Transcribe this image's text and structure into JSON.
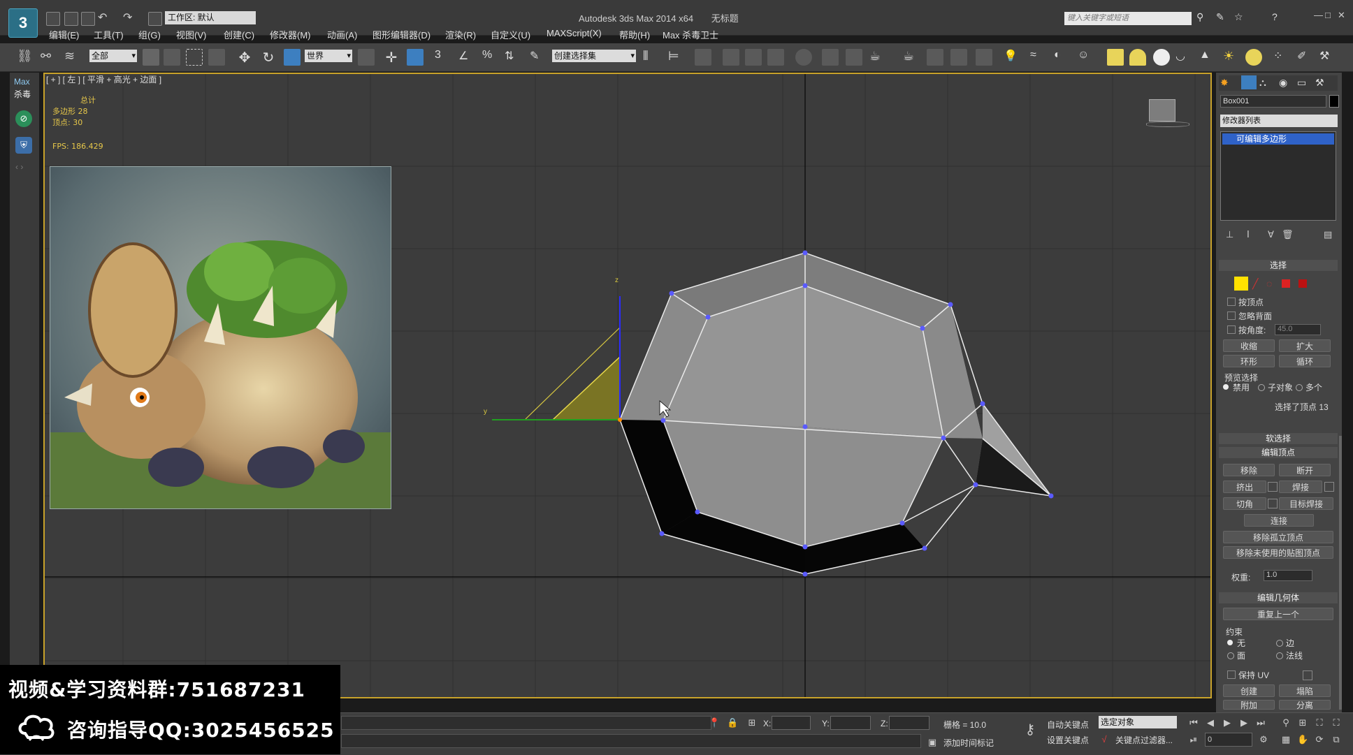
{
  "window": {
    "title": "Autodesk 3ds Max  2014 x64",
    "doc_title": "无标题",
    "logo": "3",
    "workspace_label": "工作区: 默认",
    "search_placeholder": "键入关键字或短语",
    "min": "—",
    "restore": "□",
    "close": "✕"
  },
  "menu": [
    "编辑(E)",
    "工具(T)",
    "组(G)",
    "视图(V)",
    "创建(C)",
    "修改器(M)",
    "动画(A)",
    "图形编辑器(D)",
    "渲染(R)",
    "自定义(U)",
    "MAXScript(X)",
    "帮助(H)",
    "Max 杀毒卫士"
  ],
  "toolbar": {
    "filter": "全部",
    "coord": "世界",
    "selset": "创建选择集",
    "snap3": "3",
    "snap_pct": "%"
  },
  "leftstrip": {
    "label1": "Max",
    "label2": "杀毒"
  },
  "viewport": {
    "label": "[ + ] [ 左 ] [ 平滑 + 高光 + 边面 ]",
    "stats_total": "总计",
    "stats_poly": "多边形 28",
    "stats_vert": "顶点:  30",
    "stats_fps": "FPS:  186.429",
    "axis_z": "z",
    "axis_y": "y"
  },
  "panel": {
    "object_name": "Box001",
    "modifier_list": "修改器列表",
    "stack_item": "可编辑多边形",
    "select_title": "选择",
    "by_vertex": "按顶点",
    "ignore_back": "忽略背面",
    "by_angle": "按角度:",
    "angle_value": "45.0",
    "shrink": "收缩",
    "grow": "扩大",
    "ring": "环形",
    "loop": "循环",
    "preview_sel": "预览选择",
    "disabled": "禁用",
    "subobject": "子对象",
    "multi": "多个",
    "selected_info": "选择了顶点 13",
    "soft_sel": "软选择",
    "edit_vertex": "编辑顶点",
    "remove": "移除",
    "break": "断开",
    "extrude": "挤出",
    "weld": "焊接",
    "chamfer": "切角",
    "target_weld": "目标焊接",
    "connect": "连接",
    "remove_isolated": "移除孤立顶点",
    "remove_unused": "移除未使用的贴图顶点",
    "weight_label": "权重:",
    "weight_value": "1.0",
    "edit_geom": "编辑几何体",
    "repeat_last": "重复上一个",
    "constraints": "约束",
    "c_none": "无",
    "c_edge": "边",
    "c_face": "面",
    "c_normal": "法线",
    "preserve_uv": "保持 UV",
    "create": "创建",
    "collapse": "塌陷",
    "attach": "附加",
    "detach": "分离"
  },
  "status": {
    "x_label": "X:",
    "y_label": "Y:",
    "z_label": "Z:",
    "grid": "栅格 = 10.0",
    "auto_key": "自动关键点",
    "set_key": "设置关键点",
    "selected_obj": "选定对象",
    "key_filter": "关键点过滤器...",
    "add_time_tag": "添加时间标记",
    "frame": "0"
  },
  "promo": {
    "line1": "视频&学习资料群:751687231",
    "line2": "咨询指导QQ:3025456525"
  },
  "colors": {
    "accent_yellow": "#c8a22a",
    "selection_blue": "#2f62c8",
    "vertex_blue": "#4b4bff"
  }
}
